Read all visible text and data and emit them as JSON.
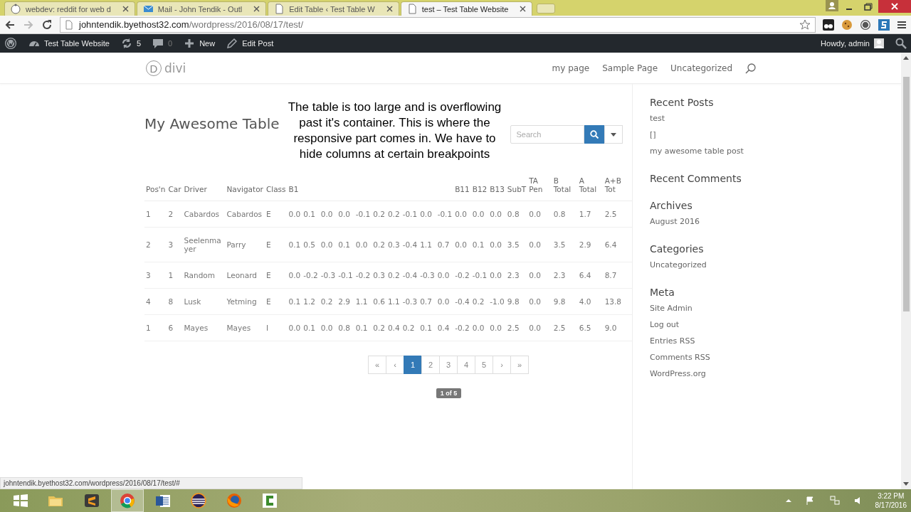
{
  "browser": {
    "tabs": [
      {
        "kind": "reddit",
        "title": "webdev: reddit for web d",
        "selected": false
      },
      {
        "kind": "mail",
        "title": "Mail - John Tendik - Outl",
        "selected": false
      },
      {
        "kind": "page",
        "title": "Edit Table ‹ Test Table W",
        "selected": false
      },
      {
        "kind": "page",
        "title": "test – Test Table Website",
        "selected": true
      }
    ],
    "url_host": "johntendik.byethost32.com",
    "url_path": "/wordpress/2016/08/17/test/"
  },
  "admin_bar": {
    "site": "Test Table Website",
    "updates": "5",
    "comments": "0",
    "new": "New",
    "edit": "Edit Post",
    "greeting": "Howdy, admin"
  },
  "site_header": {
    "logo_letter": "D",
    "logo_text": "divi",
    "nav": [
      "my page",
      "Sample Page",
      "Uncategorized"
    ]
  },
  "post": {
    "title": "My Awesome Table",
    "annotation": "The table is too large and is overflowing past it's container. This is where the responsive part comes in. We have to hide columns at certain breakpoints",
    "search": {
      "placeholder": "Search"
    },
    "table": {
      "columns": [
        {
          "label": "Pos'n"
        },
        {
          "label": "Car"
        },
        {
          "label": "Driver"
        },
        {
          "label": "Navigator"
        },
        {
          "label": "Class"
        },
        {
          "label": "B1"
        },
        {},
        {},
        {},
        {},
        {},
        {},
        {},
        {},
        {},
        {
          "label": "B11"
        },
        {
          "label": "B12"
        },
        {
          "label": "B13"
        },
        {
          "label": "SubT"
        },
        {
          "label": "TA Pen"
        },
        {
          "label": "B Total"
        },
        {
          "label": "A Total"
        },
        {
          "label": "A+B Tot"
        }
      ],
      "rows": [
        [
          "1",
          "2",
          "Cabardos",
          "Cabardos",
          "E",
          "0.0",
          "0.1",
          "0.0",
          "0.0",
          "-0.1",
          "0.2",
          "0.2",
          "-0.1",
          "0.0",
          "-0.1",
          "0.0",
          "0.0",
          "0.0",
          "0.8",
          "0.0",
          "0.8",
          "1.7",
          "2.5"
        ],
        [
          "2",
          "3",
          "Seelenmayer",
          "Parry",
          "E",
          "0.1",
          "0.5",
          "0.0",
          "0.1",
          "0.0",
          "0.2",
          "0.3",
          "-0.4",
          "1.1",
          "0.7",
          "0.0",
          "0.1",
          "0.0",
          "3.5",
          "0.0",
          "3.5",
          "2.9",
          "6.4"
        ],
        [
          "3",
          "1",
          "Random",
          "Leonard",
          "E",
          "0.0",
          "-0.2",
          "-0.3",
          "-0.1",
          "-0.2",
          "0.3",
          "0.2",
          "-0.4",
          "-0.3",
          "0.0",
          "-0.2",
          "-0.1",
          "0.0",
          "2.3",
          "0.0",
          "2.3",
          "6.4",
          "8.7"
        ],
        [
          "4",
          "8",
          "Lusk",
          "Yetming",
          "E",
          "0.1",
          "1.2",
          "0.2",
          "2.9",
          "1.1",
          "0.6",
          "1.1",
          "-0.3",
          "0.7",
          "0.0",
          "-0.4",
          "0.2",
          "-1.0",
          "9.8",
          "0.0",
          "9.8",
          "4.0",
          "13.8"
        ],
        [
          "1",
          "6",
          "Mayes",
          "Mayes",
          "I",
          "0.0",
          "0.1",
          "0.0",
          "0.8",
          "0.1",
          "0.2",
          "0.4",
          "0.2",
          "0.1",
          "0.4",
          "-0.2",
          "0.0",
          "0.0",
          "2.5",
          "0.0",
          "2.5",
          "6.5",
          "9.0"
        ]
      ]
    },
    "pagination": [
      {
        "label": "«",
        "selected": false
      },
      {
        "label": "‹",
        "selected": false
      },
      {
        "label": "1",
        "selected": true
      },
      {
        "label": "2",
        "selected": false
      },
      {
        "label": "3",
        "selected": false
      },
      {
        "label": "4",
        "selected": false
      },
      {
        "label": "5",
        "selected": false
      },
      {
        "label": "›",
        "selected": false
      },
      {
        "label": "»",
        "selected": false
      }
    ],
    "page_label": "1 of 5"
  },
  "sidebar": [
    {
      "title": "Recent Posts",
      "items": [
        "test",
        "[]",
        "my awesome table post"
      ]
    },
    {
      "title": "Recent Comments"
    },
    {
      "title": "Archives",
      "items": [
        "August 2016"
      ]
    },
    {
      "title": "Categories",
      "items": [
        "Uncategorized"
      ]
    },
    {
      "title": "Meta",
      "items": [
        "Site Admin",
        "Log out",
        "Entries RSS",
        "Comments RSS",
        "WordPress.org"
      ]
    }
  ],
  "status_bar": "johntendik.byethost32.com/wordpress/2016/08/17/test/#",
  "taskbar": {
    "apps": [
      {
        "kind": "windows",
        "selected": false
      },
      {
        "kind": "folder",
        "selected": false
      },
      {
        "kind": "sublime",
        "selected": false
      },
      {
        "kind": "chrome",
        "selected": true
      },
      {
        "kind": "word",
        "selected": false
      },
      {
        "kind": "eclipse",
        "selected": false
      },
      {
        "kind": "firefox",
        "selected": false
      },
      {
        "kind": "camtasia",
        "selected": false
      }
    ],
    "time": "3:22 PM",
    "date": "8/17/2016"
  }
}
